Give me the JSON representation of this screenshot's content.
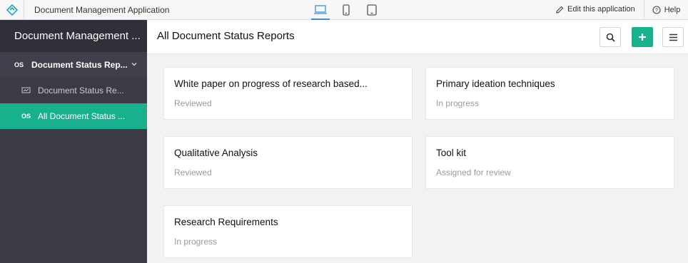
{
  "topbar": {
    "app_title": "Document Management Application",
    "edit_label": "Edit this application",
    "help_label": "Help",
    "devices": [
      "desktop",
      "phone",
      "tablet"
    ],
    "active_device": "desktop"
  },
  "sidebar": {
    "title": "Document Management ...",
    "section": {
      "icon": "OS",
      "label": "Document Status Rep..."
    },
    "items": [
      {
        "icon": "report-icon",
        "label": "Document Status Re..."
      },
      {
        "icon": "OS",
        "label": "All Document Status ..."
      }
    ]
  },
  "main": {
    "title": "All Document Status Reports",
    "cards": [
      {
        "title": "White paper on progress of research based...",
        "status": "Reviewed"
      },
      {
        "title": "Primary ideation techniques",
        "status": "In progress"
      },
      {
        "title": "Qualitative Analysis",
        "status": "Reviewed"
      },
      {
        "title": "Tool kit",
        "status": "Assigned for review"
      },
      {
        "title": "Research Requirements",
        "status": "In progress"
      }
    ]
  },
  "colors": {
    "accent": "#17b28d",
    "sidebar_bg": "#3a3b45",
    "active_device": "#3a8fd6"
  }
}
